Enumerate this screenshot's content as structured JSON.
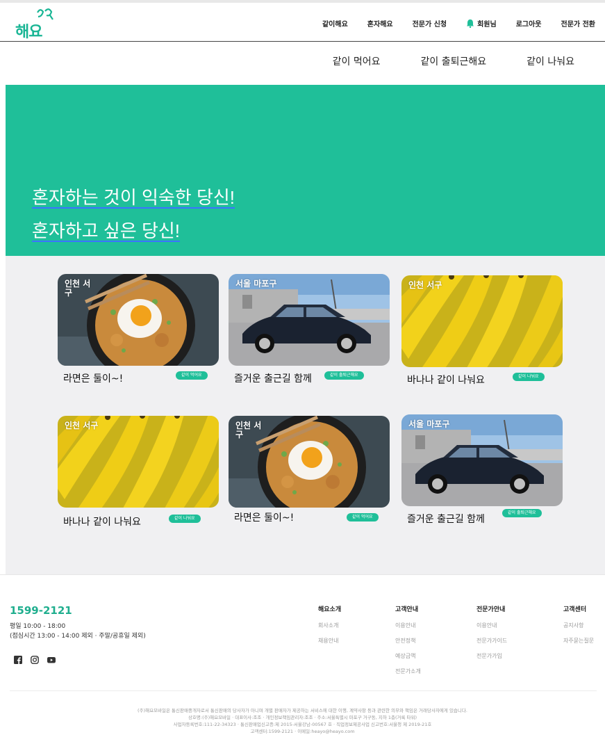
{
  "logo": {
    "text": "해요"
  },
  "topnav": {
    "items": [
      "같이해요",
      "혼자해요",
      "전문가 신청",
      "회원님",
      "로그아웃",
      "전문가 전환"
    ]
  },
  "subnav": {
    "items": [
      "같이 먹어요",
      "같이 출퇴근해요",
      "같이 나눠요"
    ]
  },
  "hero": {
    "line1": "혼자하는 것이 익숙한 당신!",
    "line2": "혼자하고 싶은 당신!"
  },
  "colors": {
    "accent": "#1fbf99",
    "underline": "#3b73ff",
    "content_bg": "#f0f0f2"
  },
  "cards": [
    {
      "location": "인천 서구",
      "title": "라면은 둘이~!",
      "badge": "같이 먹어요",
      "image": "ramen-image"
    },
    {
      "location": "서울 마포구",
      "title": "즐거운 출근길 함께",
      "badge": "같이 출퇴근해요",
      "image": "car-image"
    },
    {
      "location": "인천 서구",
      "title": "바나나 같이 나눠요",
      "badge": "같이 나눠요",
      "image": "banana-image"
    },
    {
      "location": "인천 서구",
      "title": "바나나 같이 나눠요",
      "badge": "같이 나눠요",
      "image": "banana-image"
    },
    {
      "location": "인천 서구",
      "title": "라면은 둘이~!",
      "badge": "같이 먹어요",
      "image": "ramen-image"
    },
    {
      "location": "서울 마포구",
      "title": "즐거운 출근길 함께",
      "badge": "같이 출퇴근해요",
      "image": "car-image"
    }
  ],
  "footer": {
    "phone": "1599-2121",
    "hours": "평일 10:00 - 18:00",
    "hours_note": "(점심시간 13:00 - 14:00 제외 · 주말/공휴일 제외)",
    "social": [
      "facebook-icon",
      "instagram-icon",
      "youtube-icon"
    ],
    "columns": [
      {
        "heading": "해요소개",
        "links": [
          "회사소개",
          "채용안내"
        ]
      },
      {
        "heading": "고객안내",
        "links": [
          "이용안내",
          "안전정책",
          "예상금액",
          "전문가소개"
        ]
      },
      {
        "heading": "전문가안내",
        "links": [
          "이용안내",
          "전문가가이드",
          "전문가가입"
        ]
      },
      {
        "heading": "고객센터",
        "links": [
          "공지사항",
          "자주묻는질문"
        ]
      }
    ],
    "legal": [
      "(주)해요모바일은 통신판매중개자로서 통신판매의 당사자가 아니며 개별 판매자가 제공하는 서비스에 대한 이행, 계약사항 등과 관련한 의무와 책임은 거래당사자에게 있습니다.",
      "상호명:(주)해요모바일 · 대표이사:조조 · 개인정보책임관리자:조조 · 주소:서울특별시 마포구 거구동, 지하 1층(거룩 타워)",
      "사업자등록번호:111-22-34323 · 통신판매업신고증:제 2015-서울강남-00567 호 · 직업정보제공사업 신고번호:서울청 제 2019-21호",
      "고객센터:1599-2121 · 이메일:heayo@heayo.com"
    ]
  }
}
